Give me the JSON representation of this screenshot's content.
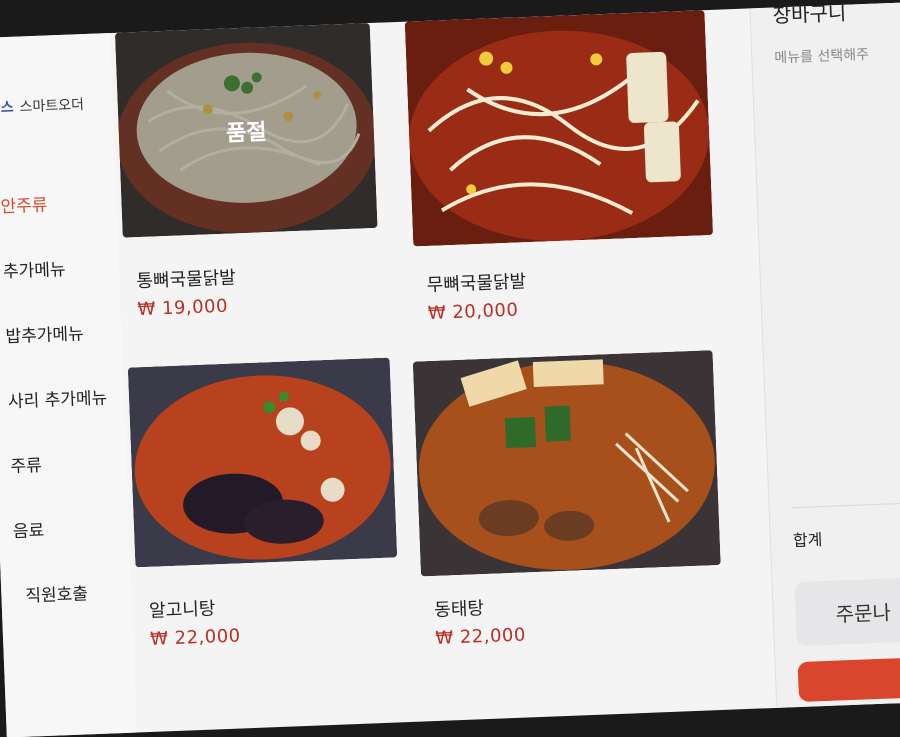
{
  "brand": {
    "mark": "스",
    "name": "스마트오더"
  },
  "categories": [
    {
      "label": "안주류",
      "active": true
    },
    {
      "label": "추가메뉴",
      "active": false
    },
    {
      "label": "밥추가메뉴",
      "active": false
    },
    {
      "label": "사리 추가메뉴",
      "active": false
    },
    {
      "label": "주류",
      "active": false
    },
    {
      "label": "음료",
      "active": false
    },
    {
      "label": "직원호출",
      "active": false
    }
  ],
  "menu": [
    {
      "name": "통뼈국물닭발",
      "price": "₩ 19,000",
      "soldout_label": "품절"
    },
    {
      "name": "무뼈국물닭발",
      "price": "₩ 20,000"
    },
    {
      "name": "알고니탕",
      "price": "₩ 22,000"
    },
    {
      "name": "동태탕",
      "price": "₩ 22,000"
    }
  ],
  "cart": {
    "title": "장바구니",
    "hint": "메뉴를 선택해주",
    "total_label": "합계",
    "order_label": "주문나"
  },
  "colors": {
    "accent": "#d9452d",
    "price": "#b83226"
  }
}
